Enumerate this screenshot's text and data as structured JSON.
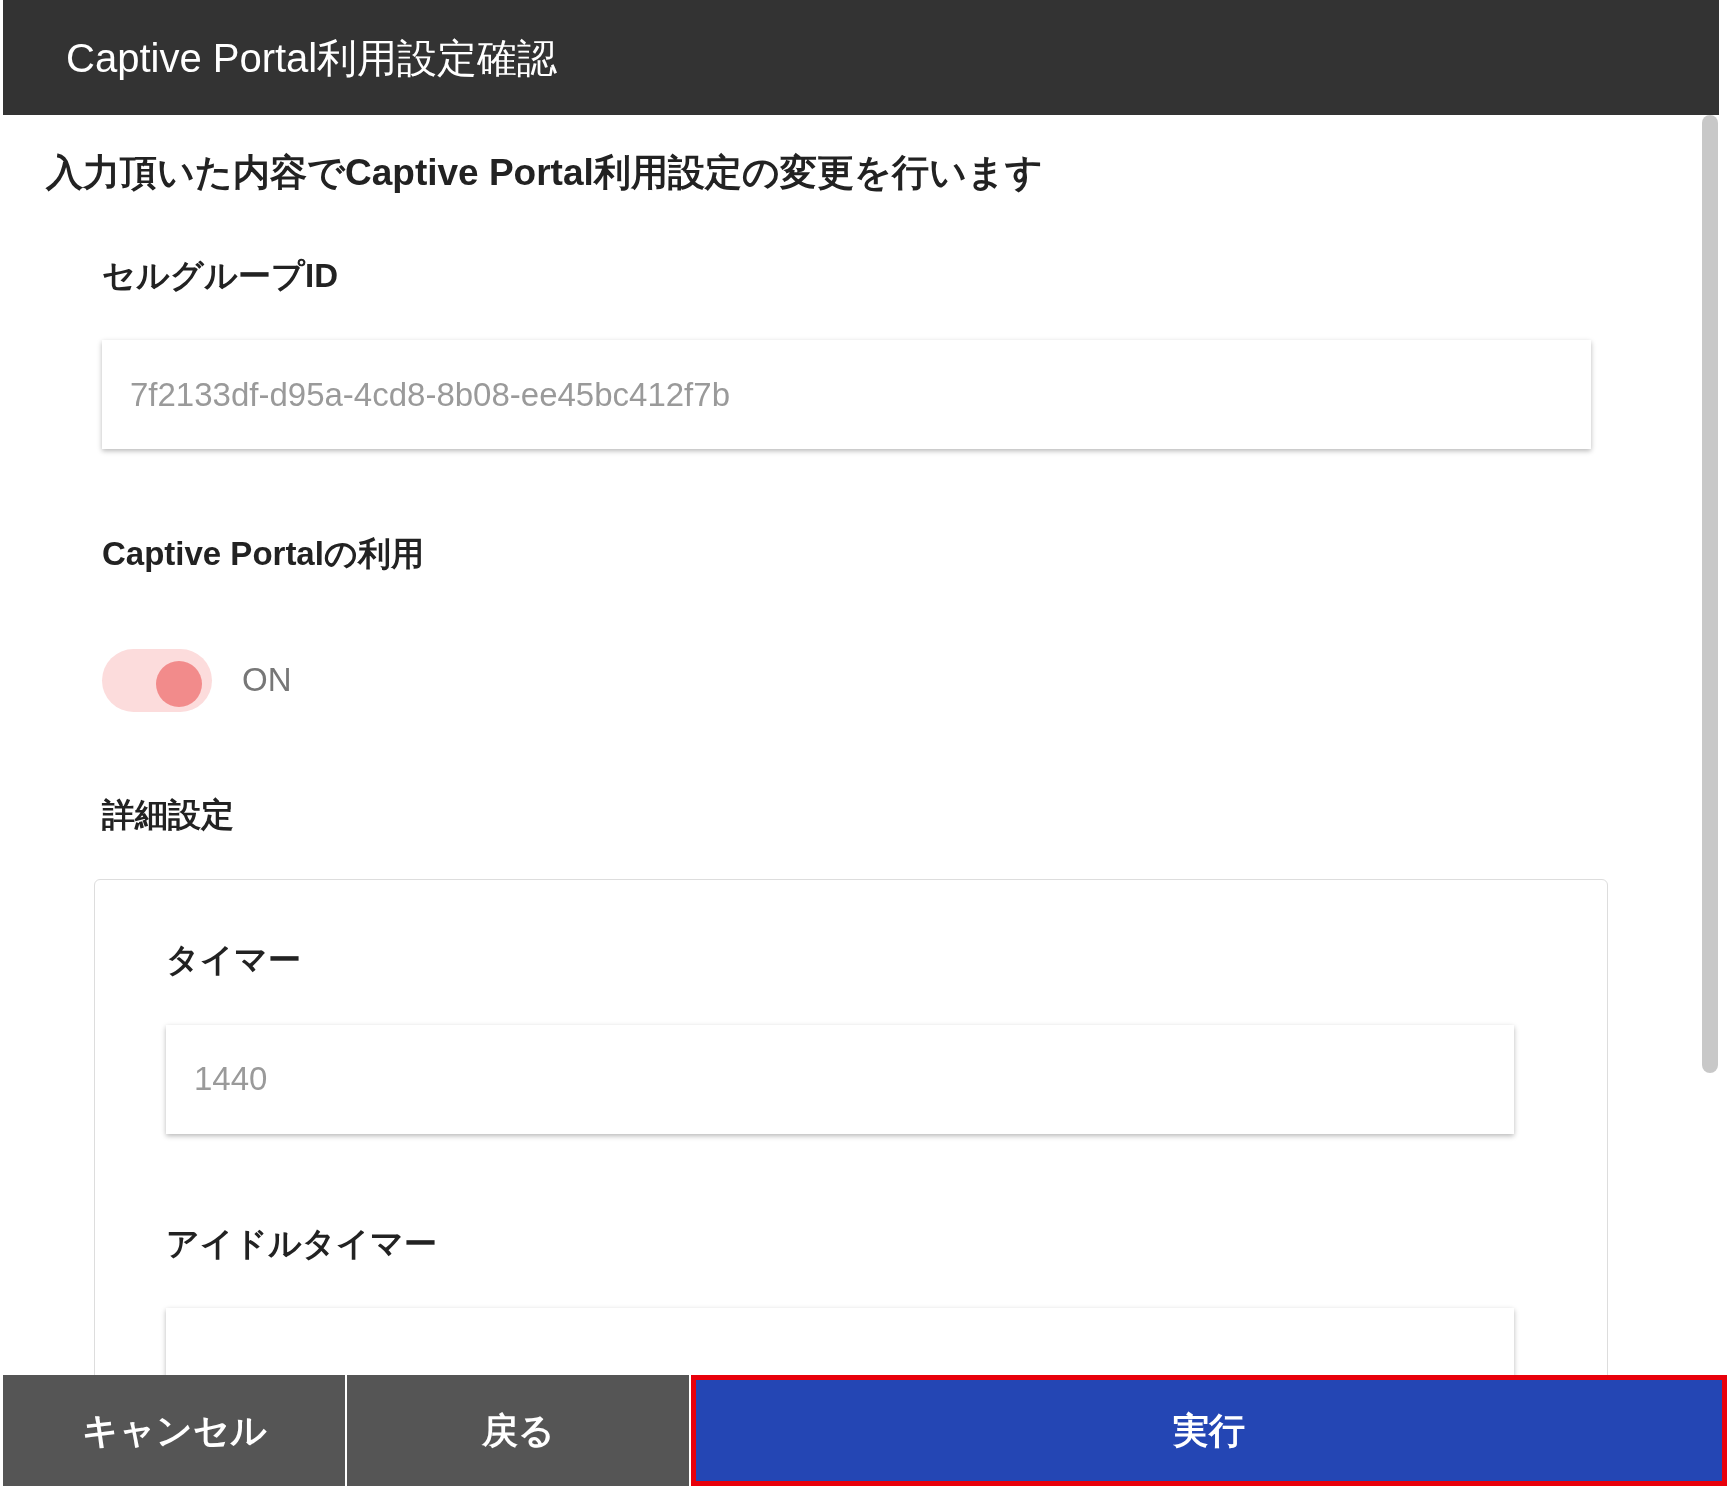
{
  "window": {
    "title": "Captive Portal利用設定確認"
  },
  "message": "入力頂いた内容でCaptive Portal利用設定の変更を行います",
  "cell_group_id": {
    "label": "セルグループID",
    "value": "7f2133df-d95a-4cd8-8b08-ee45bc412f7b"
  },
  "captive_portal": {
    "label": "Captive Portalの利用",
    "on": true,
    "state_text": "ON"
  },
  "details": {
    "label": "詳細設定",
    "fields": [
      {
        "label": "タイマー",
        "value": "1440"
      },
      {
        "label": "アイドルタイマー"
      }
    ]
  },
  "buttons": [
    {
      "label": "キャンセル",
      "kind": "secondary",
      "highlighted": false
    },
    {
      "label": "戻る",
      "kind": "secondary",
      "highlighted": false
    },
    {
      "label": "実行",
      "kind": "primary",
      "highlighted": true
    }
  ]
}
